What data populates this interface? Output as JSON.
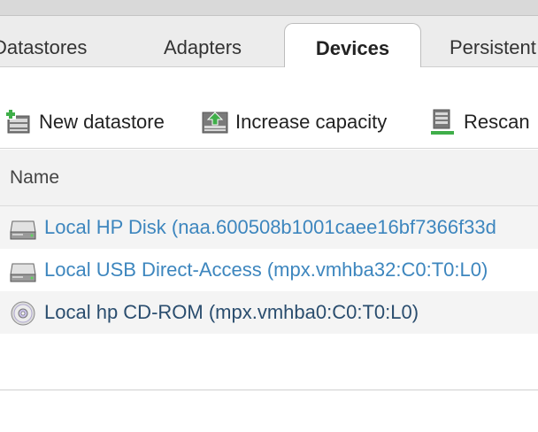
{
  "tabs": [
    {
      "label": "Datastores",
      "active": false
    },
    {
      "label": "Adapters",
      "active": false
    },
    {
      "label": "Devices",
      "active": true
    },
    {
      "label": "Persistent",
      "active": false
    }
  ],
  "toolbar": {
    "new_datastore": {
      "label": "New datastore",
      "icon": "new-datastore-icon"
    },
    "increase_capacity": {
      "label": "Increase capacity",
      "icon": "increase-capacity-icon"
    },
    "rescan": {
      "label": "Rescan",
      "icon": "rescan-icon"
    }
  },
  "table": {
    "columns": [
      "Name"
    ],
    "rows": [
      {
        "name": "Local HP Disk (naa.600508b1001caee16bf7366f33d",
        "icon": "disk-icon",
        "link": true
      },
      {
        "name": "Local USB Direct-Access (mpx.vmhba32:C0:T0:L0)",
        "icon": "disk-icon",
        "link": true
      },
      {
        "name": "Local hp CD-ROM (mpx.vmhba0:C0:T0:L0)",
        "icon": "cdrom-icon",
        "link": false
      }
    ]
  },
  "colors": {
    "link": "#3d86be",
    "text_dark": "#2a4d6e",
    "tab_bar_bg": "#ececec",
    "header_bg": "#f2f2f2"
  }
}
